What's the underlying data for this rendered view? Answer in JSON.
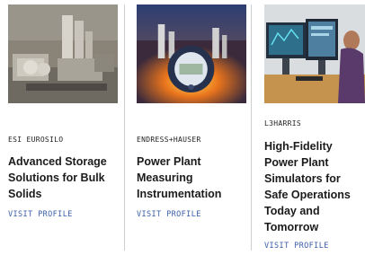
{
  "cards": [
    {
      "company": "ESI EUROSILO",
      "title_lines": [
        "Advanced Storage",
        "Solutions for Bulk",
        "Solids"
      ],
      "link": "VISIT PROFILE",
      "image_icon": "industrial-plant-photo"
    },
    {
      "company": "ENDRESS+HAUSER",
      "title_lines": [
        "Power Plant",
        "Measuring",
        "Instrumentation"
      ],
      "link": "VISIT PROFILE",
      "image_icon": "gauge-device-photo"
    },
    {
      "company": "L3HARRIS",
      "title_lines": [
        "High-Fidelity",
        "Power Plant",
        "Simulators for",
        "Safe Operations",
        "Today and",
        "Tomorrow"
      ],
      "link": "VISIT PROFILE",
      "image_icon": "control-room-photo"
    }
  ],
  "colors": {
    "link": "#3a5da8",
    "title": "#1b1b1b",
    "divider": "#cfcfcf"
  }
}
